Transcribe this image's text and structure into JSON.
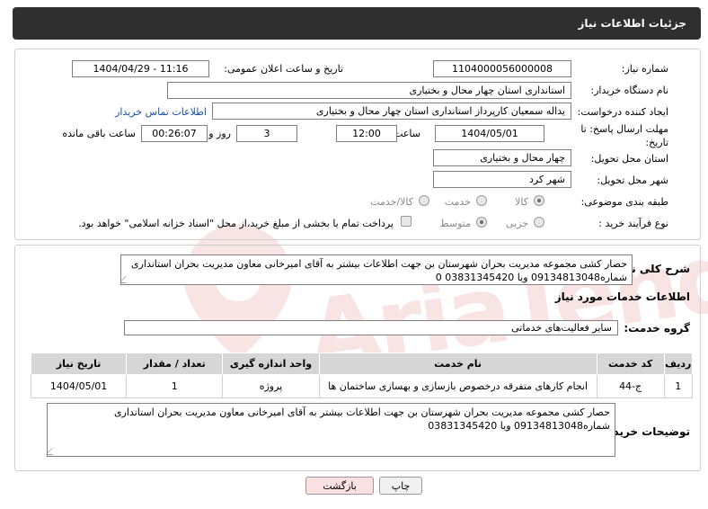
{
  "header": {
    "title": "جزئیات اطلاعات نیاز"
  },
  "watermark": {
    "text": "AriaTender.neT"
  },
  "form": {
    "need_number_label": "شماره نیاز:",
    "need_number": "1104000056000008",
    "announce_label": "تاریخ و ساعت اعلان عمومی:",
    "announce_value": "1404/04/29 - 11:16",
    "buyer_org_label": "نام دستگاه خریدار:",
    "buyer_org": "استانداری استان چهار محال و بختیاری",
    "requester_label": "ایجاد کننده درخواست:",
    "requester": "یداله  سمعیان  کارپرداز استانداری استان چهار محال و بختیاری",
    "contact_link": "اطلاعات تماس خریدار",
    "deadline_label": "مهلت ارسال پاسخ: تا تاریخ:",
    "deadline_date": "1404/05/01",
    "time_label": "ساعت",
    "deadline_time": "12:00",
    "days_value": "3",
    "days_label": "روز و",
    "remaining_time": "00:26:07",
    "remaining_label": "ساعت باقی مانده",
    "province_label": "استان محل تحویل:",
    "province": "چهار محال و بختیاری",
    "city_label": "شهر محل تحویل:",
    "city": "شهر کرد",
    "category_label": "طبقه بندی موضوعی:",
    "category_options": [
      "کالا",
      "خدمت",
      "کالا/خدمت"
    ],
    "process_label": "نوع فرآیند خرید :",
    "process_options": [
      "جزیی",
      "متوسط"
    ],
    "payment_note": "پرداخت تمام یا بخشی از مبلغ خرید،از محل \"اسناد خزانه اسلامی\" خواهد بود."
  },
  "description": {
    "label": "شرح کلی نیاز:",
    "text": "حصار کشی مجموعه مدیریت بحران شهرستان بن جهت اطلاعات بیشتر به آقای امیرخانی معاون مدیریت بحران استانداری شماره09134813048 ویا 03831345420 0"
  },
  "services": {
    "section_title": "اطلاعات خدمات مورد نیاز",
    "group_label": "گروه خدمت:",
    "group_value": "سایر فعالیت‌های خدماتی",
    "columns": [
      "ردیف",
      "کد خدمت",
      "نام خدمت",
      "واحد اندازه گیری",
      "تعداد / مقدار",
      "تاریخ نیاز"
    ],
    "rows": [
      {
        "index": "1",
        "code": "ج-44",
        "name": "انجام کارهای متفرقه درخصوص بازسازی و بهسازی ساختمان ها",
        "unit": "پروژه",
        "qty": "1",
        "date": "1404/05/01"
      }
    ]
  },
  "buyer_notes": {
    "label": "توضیحات خریدار:",
    "text": "حصار کشی مجموعه مدیریت بحران شهرستان بن جهت اطلاعات بیشتر به آقای امیرخانی معاون مدیریت بحران استانداری شماره09134813048 ویا 03831345420"
  },
  "buttons": {
    "print": "چاپ",
    "back": "بازگشت"
  },
  "colors": {
    "header_bg": "#2f2f2f",
    "link": "#1a4fa8",
    "back_button_bg": "#fbe1e1",
    "table_header_bg": "#d6d6d6"
  }
}
